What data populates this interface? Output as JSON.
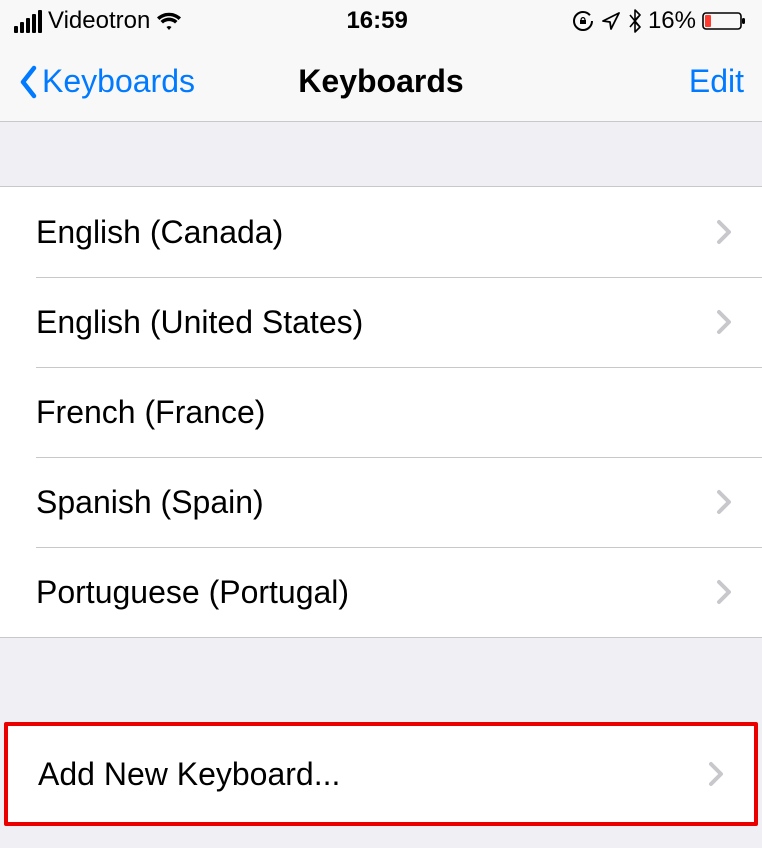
{
  "status_bar": {
    "carrier": "Videotron",
    "time": "16:59",
    "battery_percent": "16%"
  },
  "nav_bar": {
    "back_label": "Keyboards",
    "title": "Keyboards",
    "edit_label": "Edit"
  },
  "keyboards": [
    {
      "label": "English (Canada)",
      "has_chevron": true
    },
    {
      "label": "English (United States)",
      "has_chevron": true
    },
    {
      "label": "French (France)",
      "has_chevron": false
    },
    {
      "label": "Spanish (Spain)",
      "has_chevron": true
    },
    {
      "label": "Portuguese (Portugal)",
      "has_chevron": true
    }
  ],
  "add_row": {
    "label": "Add New Keyboard...",
    "highlighted": true
  },
  "colors": {
    "accent": "#007AFF",
    "highlight_border": "#EB0000",
    "chevron": "#C7C7CC",
    "separator": "#C8C7CC",
    "group_bg": "#EFEFF4"
  }
}
